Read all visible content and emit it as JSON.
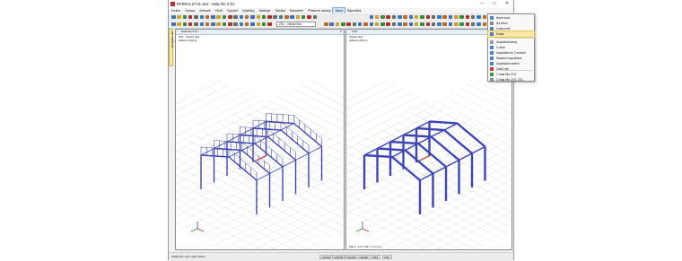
{
  "window": {
    "title": "RFEM 5.27.01 x64 - Hala Hle 2.RJ",
    "minimize": "─",
    "maximize": "□",
    "close": "✕"
  },
  "menubar": [
    {
      "label": "Soubor"
    },
    {
      "label": "Úpravy"
    },
    {
      "label": "Zobrazit"
    },
    {
      "label": "Vložit"
    },
    {
      "label": "Výpočet"
    },
    {
      "label": "Výsledky"
    },
    {
      "label": "Nástroje"
    },
    {
      "label": "Tabulka"
    },
    {
      "label": "Nastavení"
    },
    {
      "label": "Přídavné moduly"
    },
    {
      "label": "Okno",
      "active": true
    },
    {
      "label": "Nápověda"
    }
  ],
  "toolbar": {
    "model_combo": "ZS1 - Vlastní tíha"
  },
  "nav_tab": {
    "label": "Navigátor dat"
  },
  "pane_left": {
    "title": "Hala Hle 2.RJ",
    "info_line1": "ZS1 : Vlastní tíha",
    "info_line2": "Zatížení [kN/m]"
  },
  "pane_right": {
    "title": "2.RJ",
    "info_line1": "Vlastní tíha",
    "info_line2": "Zatížení [kN/m]",
    "status_line": "Max u: 12.0, Min u: 0.0 mm"
  },
  "window_menu": {
    "items": [
      {
        "label": "Nové okno",
        "icon_color": "#4a7fc4"
      },
      {
        "label": "Na celou",
        "icon_color": "#8a8a8a"
      },
      {
        "label": "Vodorovně",
        "icon_color": "#4a7fc4"
      },
      {
        "label": "Svisle",
        "icon_color": "#4a7fc4",
        "highlighted": true
      },
      {
        "label": "Uspořádat ikony",
        "icon_color": "#9a9a9a"
      },
      {
        "label": "2 okna",
        "icon_color": "#4a7fc4"
      },
      {
        "label": "Uspořádat ve 2 oknech",
        "icon_color": "#4a7fc4"
      },
      {
        "label": "Nastavit uspořádání",
        "icon_color": "#4a7fc4"
      },
      {
        "label": "Uspořádat vlastně",
        "icon_color": "#4a7fc4"
      },
      {
        "label": "Zavřít vše",
        "icon_color": "#c0392b"
      },
      {
        "label": "1 Hala Hle 2.RJ",
        "icon_color": "#2e9e3e",
        "checked": true
      },
      {
        "label": "2 Hala Hle 2.RJ, ZS1",
        "icon_color": "#8a8a8a"
      }
    ]
  },
  "statusbar": {
    "text": "Stisknutím dvou nebo tiskne",
    "buttons": [
      {
        "label": "UCHOP"
      },
      {
        "label": "RASTR"
      },
      {
        "label": "KSOUR"
      },
      {
        "label": "OSNAP"
      },
      {
        "label": "VODÍ"
      },
      {
        "label": "DXF"
      }
    ]
  },
  "colors": {
    "structure": "#3d46b8",
    "load_arrow": "#222a90",
    "grid": "#d4d4d4",
    "highlight_member": "#e02020",
    "axis_x": "#d02020",
    "axis_y": "#20a020",
    "axis_z": "#2040d0",
    "menu_highlight": "#fbe7a5"
  }
}
